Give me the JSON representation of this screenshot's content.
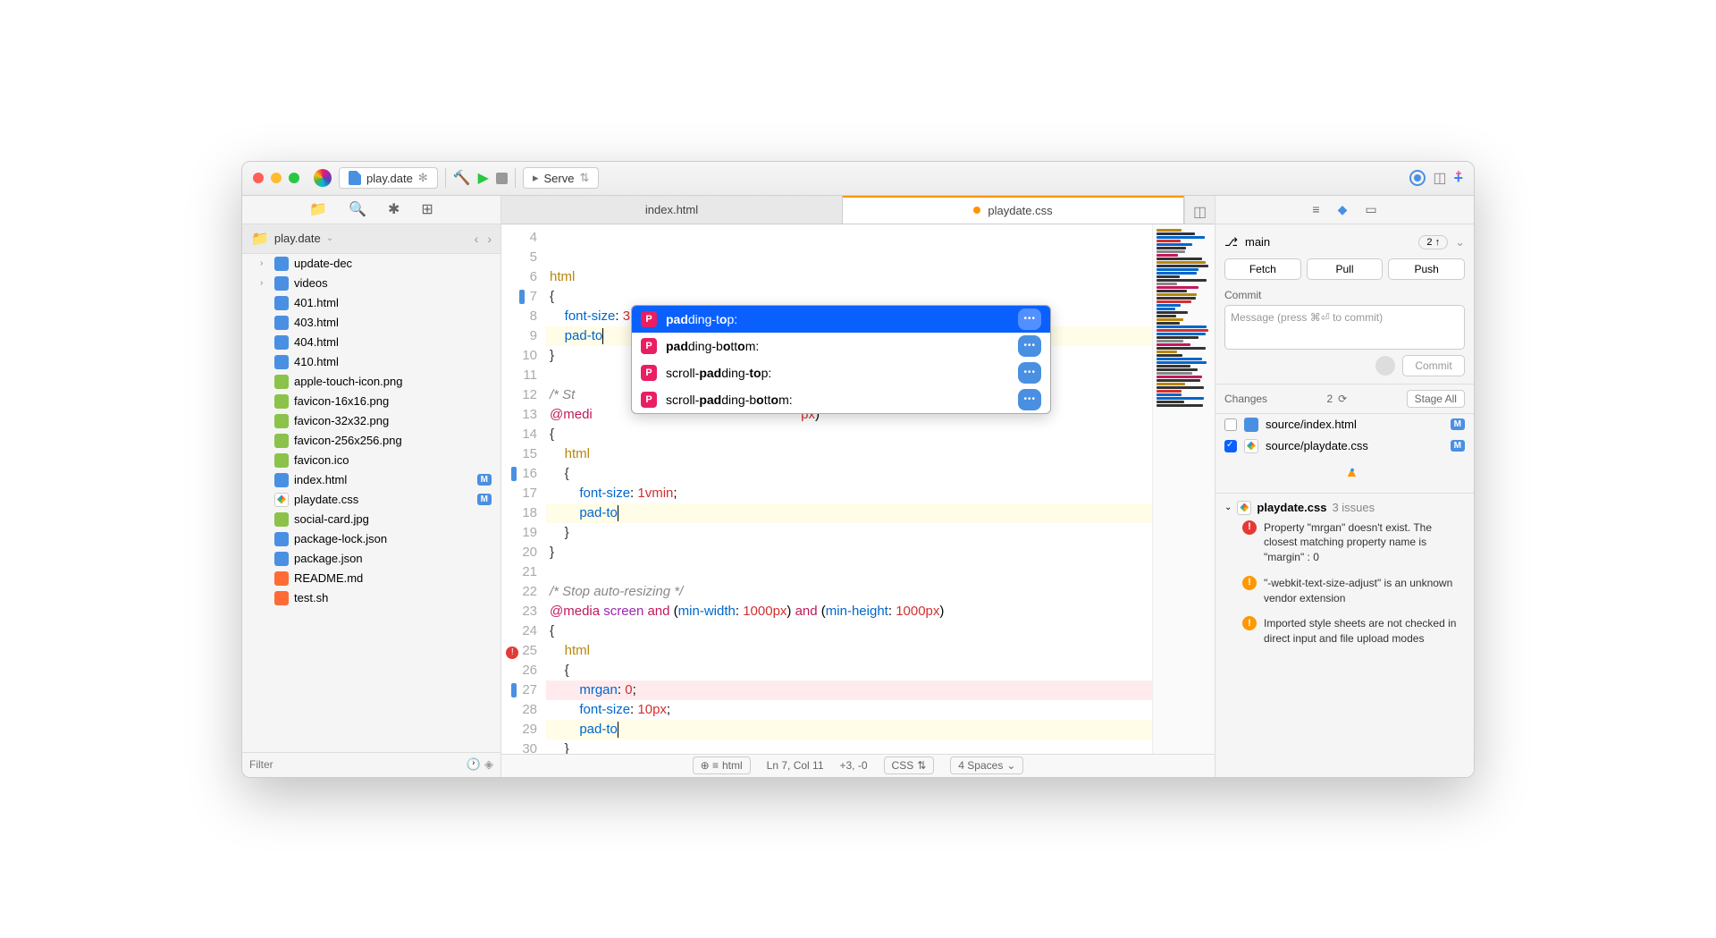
{
  "titlebar": {
    "project_tab": "play.date",
    "serve_label": "Serve"
  },
  "sidebar": {
    "root": "play.date",
    "filter_placeholder": "Filter",
    "items": [
      {
        "type": "folder",
        "name": "update-dec",
        "level": 1,
        "expandable": true
      },
      {
        "type": "folder",
        "name": "videos",
        "level": 1,
        "expandable": true
      },
      {
        "type": "html",
        "name": "401.html",
        "level": 2
      },
      {
        "type": "html",
        "name": "403.html",
        "level": 2
      },
      {
        "type": "html",
        "name": "404.html",
        "level": 2
      },
      {
        "type": "html",
        "name": "410.html",
        "level": 2
      },
      {
        "type": "img",
        "name": "apple-touch-icon.png",
        "level": 2
      },
      {
        "type": "img",
        "name": "favicon-16x16.png",
        "level": 2
      },
      {
        "type": "img",
        "name": "favicon-32x32.png",
        "level": 2
      },
      {
        "type": "img",
        "name": "favicon-256x256.png",
        "level": 2
      },
      {
        "type": "img",
        "name": "favicon.ico",
        "level": 2
      },
      {
        "type": "html",
        "name": "index.html",
        "level": 2,
        "badge": "M"
      },
      {
        "type": "css",
        "name": "playdate.css",
        "level": 2,
        "badge": "M"
      },
      {
        "type": "img",
        "name": "social-card.jpg",
        "level": 2
      },
      {
        "type": "json",
        "name": "package-lock.json",
        "level": 1
      },
      {
        "type": "json",
        "name": "package.json",
        "level": 1
      },
      {
        "type": "md",
        "name": "README.md",
        "level": 1
      },
      {
        "type": "sh",
        "name": "test.sh",
        "level": 1
      }
    ]
  },
  "tabs": [
    {
      "name": "index.html",
      "active": false,
      "modified": false
    },
    {
      "name": "playdate.css",
      "active": true,
      "modified": true
    }
  ],
  "code_lines": [
    {
      "n": 4,
      "html": "<span class='sel'>html</span>"
    },
    {
      "n": 5,
      "html": "<span class='brace'>{</span>"
    },
    {
      "n": 6,
      "html": "    <span class='prop'>font-size</span>: <span class='num'>3.8px</span>;"
    },
    {
      "n": 7,
      "html": "    <span class='prop'>pad-to</span><span class='cursor'></span>",
      "hl": true,
      "mark": true
    },
    {
      "n": 8,
      "html": "<span class='brace'>}</span>"
    },
    {
      "n": 9,
      "html": ""
    },
    {
      "n": 10,
      "html": "<span class='comment'>/* St</span>"
    },
    {
      "n": 11,
      "html": "<span class='at'>@medi</span>                                                        <span class='num'>px</span>)"
    },
    {
      "n": 12,
      "html": "<span class='brace'>{</span>"
    },
    {
      "n": 13,
      "html": "    <span class='sel'>html</span>"
    },
    {
      "n": 14,
      "html": "    <span class='brace'>{</span>"
    },
    {
      "n": 15,
      "html": "        <span class='prop'>font-size</span>: <span class='num'>1vmin</span>;"
    },
    {
      "n": 16,
      "html": "        <span class='prop'>pad-to</span><span class='cursor'></span>",
      "hl": true,
      "mark": true
    },
    {
      "n": 17,
      "html": "    <span class='brace'>}</span>"
    },
    {
      "n": 18,
      "html": "<span class='brace'>}</span>"
    },
    {
      "n": 19,
      "html": ""
    },
    {
      "n": 20,
      "html": "<span class='comment'>/* Stop auto-resizing */</span>"
    },
    {
      "n": 21,
      "html": "<span class='at'>@media</span> <span class='fn'>screen</span> <span class='at'>and</span> (<span class='prop'>min-width</span>: <span class='num'>1000px</span>) <span class='at'>and</span> (<span class='prop'>min-height</span>: <span class='num'>1000px</span>)"
    },
    {
      "n": 22,
      "html": "<span class='brace'>{</span>"
    },
    {
      "n": 23,
      "html": "    <span class='sel'>html</span>"
    },
    {
      "n": 24,
      "html": "    <span class='brace'>{</span>"
    },
    {
      "n": 25,
      "html": "        <span class='prop'>mrgan</span>: <span class='num'>0</span>;",
      "err": true
    },
    {
      "n": 26,
      "html": "        <span class='prop'>font-size</span>: <span class='num'>10px</span>;"
    },
    {
      "n": 27,
      "html": "        <span class='prop'>pad-to</span><span class='cursor'></span>",
      "hl": true,
      "mark": true
    },
    {
      "n": 28,
      "html": "    <span class='brace'>}</span>"
    },
    {
      "n": 29,
      "html": "<span class='brace'>}</span>"
    },
    {
      "n": 30,
      "html": ""
    }
  ],
  "autocomplete": [
    {
      "label": "padding-top:",
      "bold": "pad",
      "mid": "ding-t",
      "bold2": "o",
      "rest": "p:",
      "selected": true
    },
    {
      "label": "padding-bottom:",
      "bold": "pad",
      "mid": "ding-b",
      "bold2": "o",
      "rest": "tt",
      "bold3": "o",
      "rest2": "m:"
    },
    {
      "label": "scroll-padding-top:",
      "pre": "scroll-",
      "bold": "pad",
      "mid": "ding-",
      "bold2": "to",
      "rest": "p:"
    },
    {
      "label": "scroll-padding-bottom:",
      "pre": "scroll-",
      "bold": "pad",
      "mid": "ding-b",
      "bold2": "o",
      "rest": "tt",
      "bold3": "o",
      "rest2": "m:"
    }
  ],
  "statusbar": {
    "symbol": "html",
    "position": "Ln 7, Col 11",
    "diff": "+3, -0",
    "lang": "CSS",
    "indent": "4 Spaces"
  },
  "git": {
    "branch": "main",
    "ahead": "2 ↑",
    "fetch": "Fetch",
    "pull": "Pull",
    "push": "Push",
    "commit_label": "Commit",
    "commit_placeholder": "Message (press ⌘⏎ to commit)",
    "commit_btn": "Commit",
    "changes_label": "Changes",
    "changes_count": "2",
    "stage_all": "Stage All",
    "changes": [
      {
        "name": "source/index.html",
        "icon": "html",
        "checked": false,
        "badge": "M"
      },
      {
        "name": "source/playdate.css",
        "icon": "css",
        "checked": true,
        "badge": "M"
      }
    ]
  },
  "issues": {
    "file": "playdate.css",
    "count": "3 issues",
    "items": [
      {
        "type": "err",
        "text": "Property \"mrgan\" doesn't exist. The closest matching property name is \"margin\" : 0"
      },
      {
        "type": "warn",
        "text": "\"-webkit-text-size-adjust\" is an unknown vendor extension"
      },
      {
        "type": "warn",
        "text": "Imported style sheets are not checked in direct input and file upload modes"
      }
    ]
  }
}
